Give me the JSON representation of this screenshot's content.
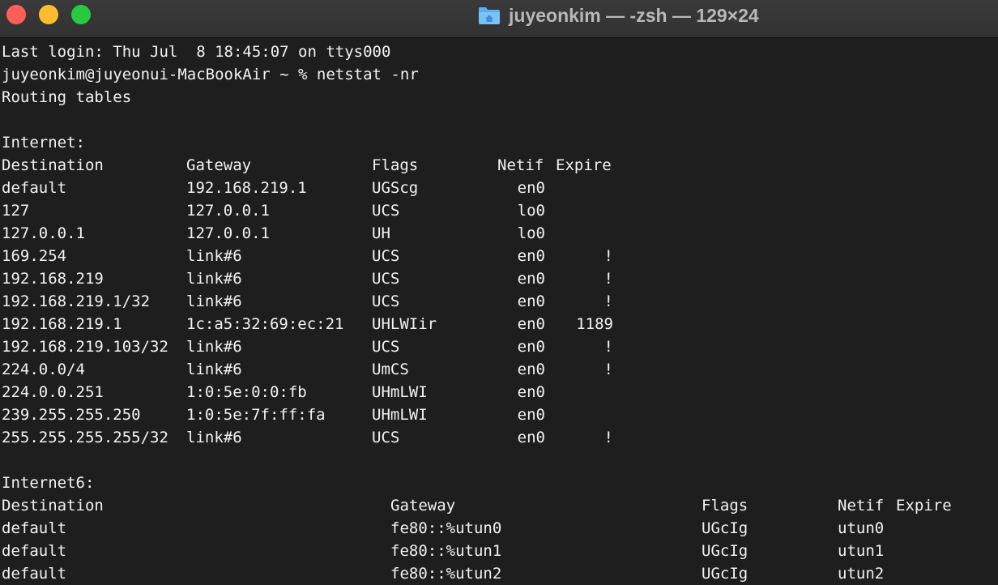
{
  "window": {
    "title": "juyeonkim — -zsh — 129×24",
    "title_icon": "home-folder-icon",
    "colors": {
      "close": "#ff5f57",
      "minimize": "#febc2e",
      "maximize": "#28c840",
      "folder": "#5ab0f0"
    }
  },
  "terminal": {
    "last_login": "Last login: Thu Jul  8 18:45:07 on ttys000",
    "prompt": "juyeonkim@juyeonui-MacBookAir ~ % netstat -nr",
    "routing_header": "Routing tables",
    "inet_section": "Internet:",
    "inet_headers": {
      "dest": "Destination",
      "gw": "Gateway",
      "flags": "Flags",
      "netif": "Netif",
      "expire": "Expire"
    },
    "inet_rows": [
      {
        "dest": "default",
        "gw": "192.168.219.1",
        "flags": "UGScg",
        "netif": "en0",
        "expire": ""
      },
      {
        "dest": "127",
        "gw": "127.0.0.1",
        "flags": "UCS",
        "netif": "lo0",
        "expire": ""
      },
      {
        "dest": "127.0.0.1",
        "gw": "127.0.0.1",
        "flags": "UH",
        "netif": "lo0",
        "expire": ""
      },
      {
        "dest": "169.254",
        "gw": "link#6",
        "flags": "UCS",
        "netif": "en0",
        "expire": "!"
      },
      {
        "dest": "192.168.219",
        "gw": "link#6",
        "flags": "UCS",
        "netif": "en0",
        "expire": "!"
      },
      {
        "dest": "192.168.219.1/32",
        "gw": "link#6",
        "flags": "UCS",
        "netif": "en0",
        "expire": "!"
      },
      {
        "dest": "192.168.219.1",
        "gw": "1c:a5:32:69:ec:21",
        "flags": "UHLWIir",
        "netif": "en0",
        "expire": "1189"
      },
      {
        "dest": "192.168.219.103/32",
        "gw": "link#6",
        "flags": "UCS",
        "netif": "en0",
        "expire": "!"
      },
      {
        "dest": "224.0.0/4",
        "gw": "link#6",
        "flags": "UmCS",
        "netif": "en0",
        "expire": "!"
      },
      {
        "dest": "224.0.0.251",
        "gw": "1:0:5e:0:0:fb",
        "flags": "UHmLWI",
        "netif": "en0",
        "expire": ""
      },
      {
        "dest": "239.255.255.250",
        "gw": "1:0:5e:7f:ff:fa",
        "flags": "UHmLWI",
        "netif": "en0",
        "expire": ""
      },
      {
        "dest": "255.255.255.255/32",
        "gw": "link#6",
        "flags": "UCS",
        "netif": "en0",
        "expire": "!"
      }
    ],
    "inet6_section": "Internet6:",
    "inet6_headers": {
      "dest": "Destination",
      "gw": "Gateway",
      "flags": "Flags",
      "netif": "Netif",
      "expire": "Expire"
    },
    "inet6_rows": [
      {
        "dest": "default",
        "gw": "fe80::%utun0",
        "flags": "UGcIg",
        "netif": "utun0"
      },
      {
        "dest": "default",
        "gw": "fe80::%utun1",
        "flags": "UGcIg",
        "netif": "utun1"
      },
      {
        "dest": "default",
        "gw": "fe80::%utun2",
        "flags": "UGcIg",
        "netif": "utun2"
      }
    ]
  }
}
